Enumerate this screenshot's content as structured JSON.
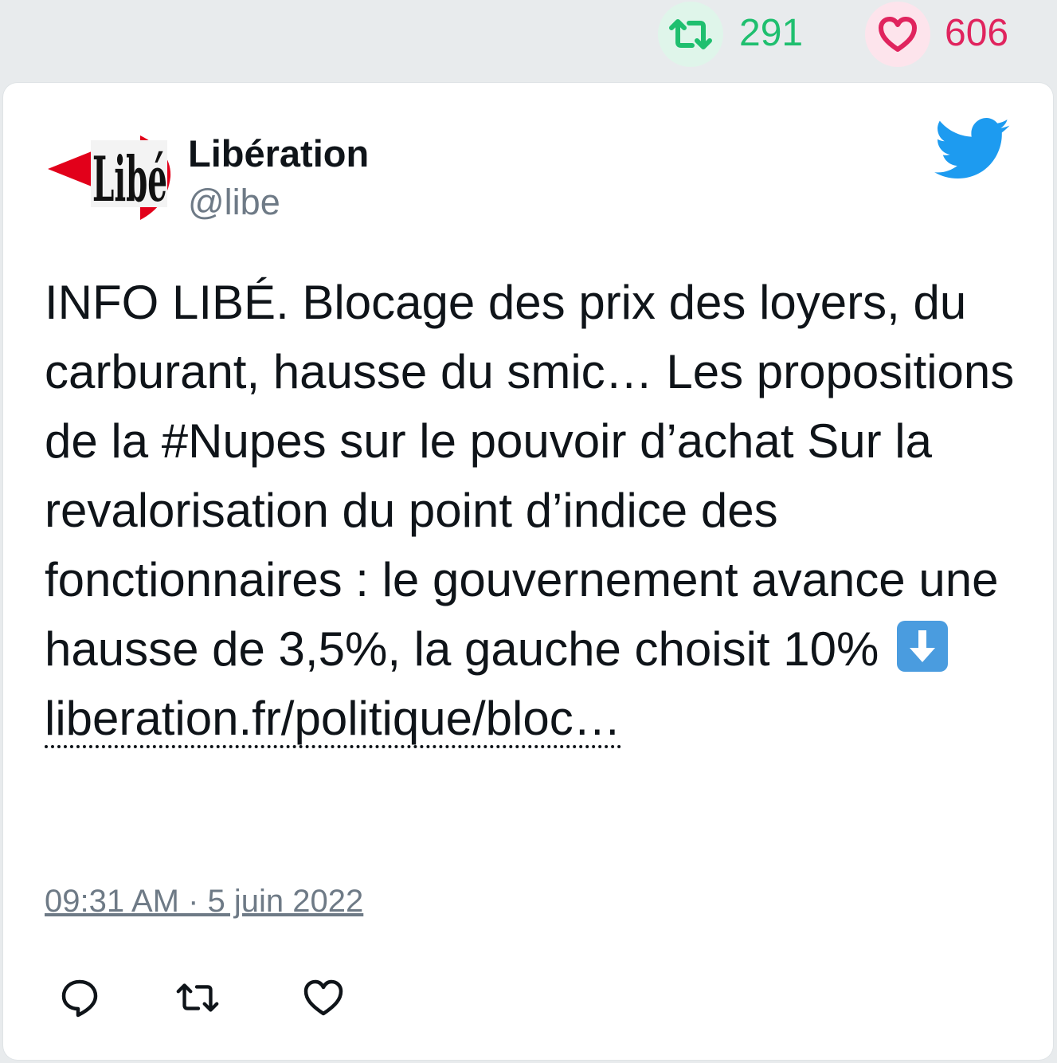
{
  "stats": {
    "retweets": "291",
    "likes": "606",
    "retweet_color": "#1fbf6f",
    "like_color": "#e0245e"
  },
  "author": {
    "name": "Libération",
    "handle": "@libe",
    "avatar_logo_text": "Libé"
  },
  "tweet": {
    "text": "INFO LIBÉ. Blocage des prix des loyers, du carburant, hausse du smic… Les propositions de la #Nupes sur le pouvoir d’achat Sur la revalorisation du point d’indice des fonctionnaires : le gouvernement avance une hausse de 3,5%, la gauche choisit 10%",
    "emoji": "down-arrow-emoji",
    "link": "liberation.fr/politique/bloc…",
    "timestamp": "09:31 AM · 5 juin 2022"
  },
  "icons": {
    "brand": "twitter-bird-icon",
    "reply": "reply-icon",
    "retweet": "retweet-icon",
    "like": "heart-icon"
  },
  "colors": {
    "twitter_blue": "#1d9bf0",
    "text": "#0f1419",
    "muted": "#6e7a86"
  }
}
